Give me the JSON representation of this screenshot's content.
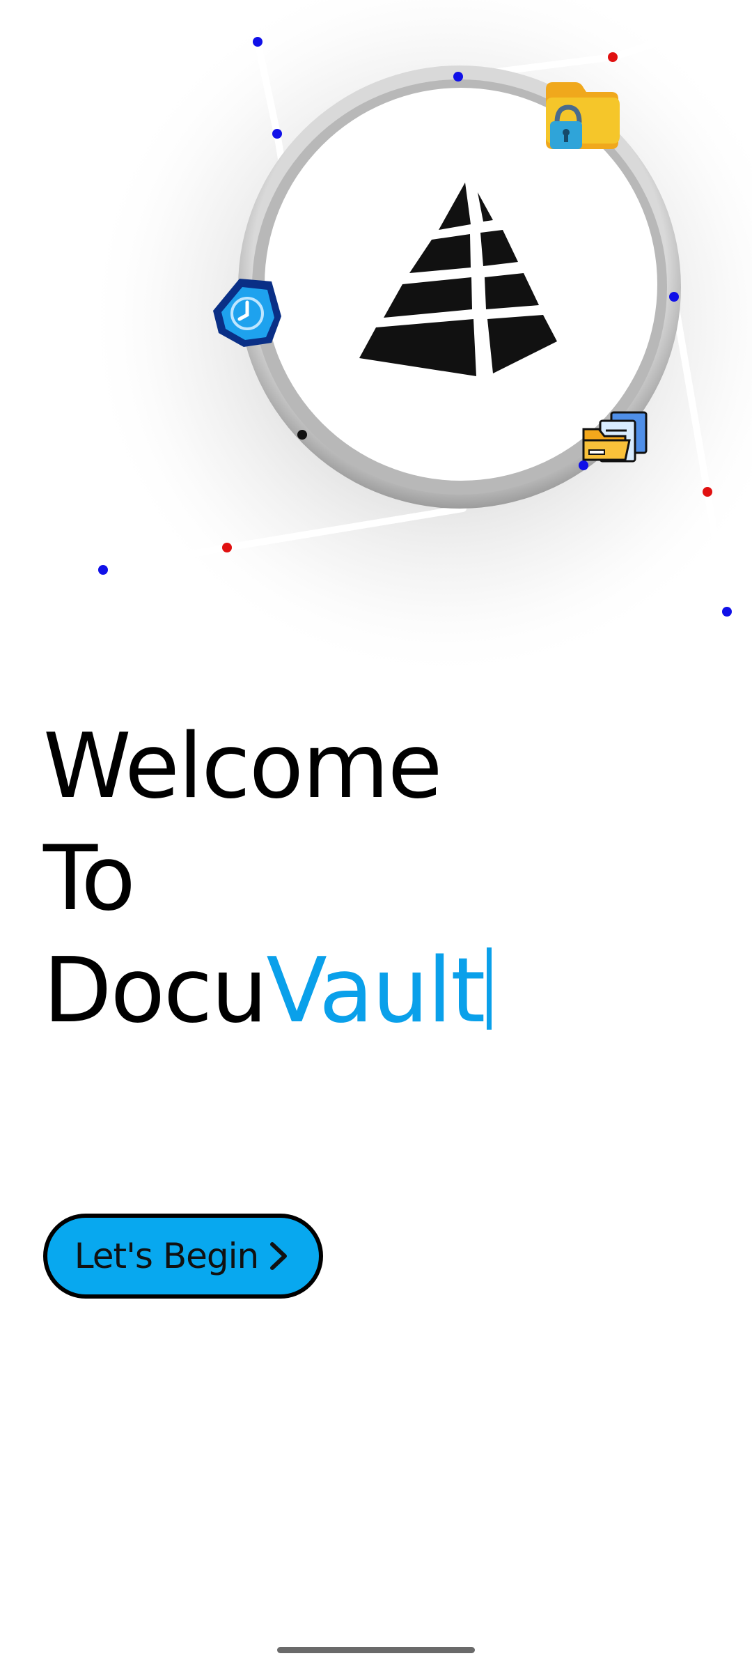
{
  "app": {
    "name_part1": "Docu",
    "name_part2": "Vault"
  },
  "welcome": {
    "line1": "Welcome",
    "line2": "To"
  },
  "cta": {
    "label": "Let's Begin"
  },
  "hero": {
    "center_icon": "pyramid-logo-icon",
    "orbit_icons": [
      "locked-folder-icon",
      "shield-clock-icon",
      "folder-documents-icon"
    ]
  },
  "colors": {
    "accent": "#0aa0ea",
    "button_fill": "#08a8ef",
    "text": "#000000",
    "dot_blue": "#1010e8",
    "dot_red": "#e01010",
    "dot_black": "#111111"
  }
}
